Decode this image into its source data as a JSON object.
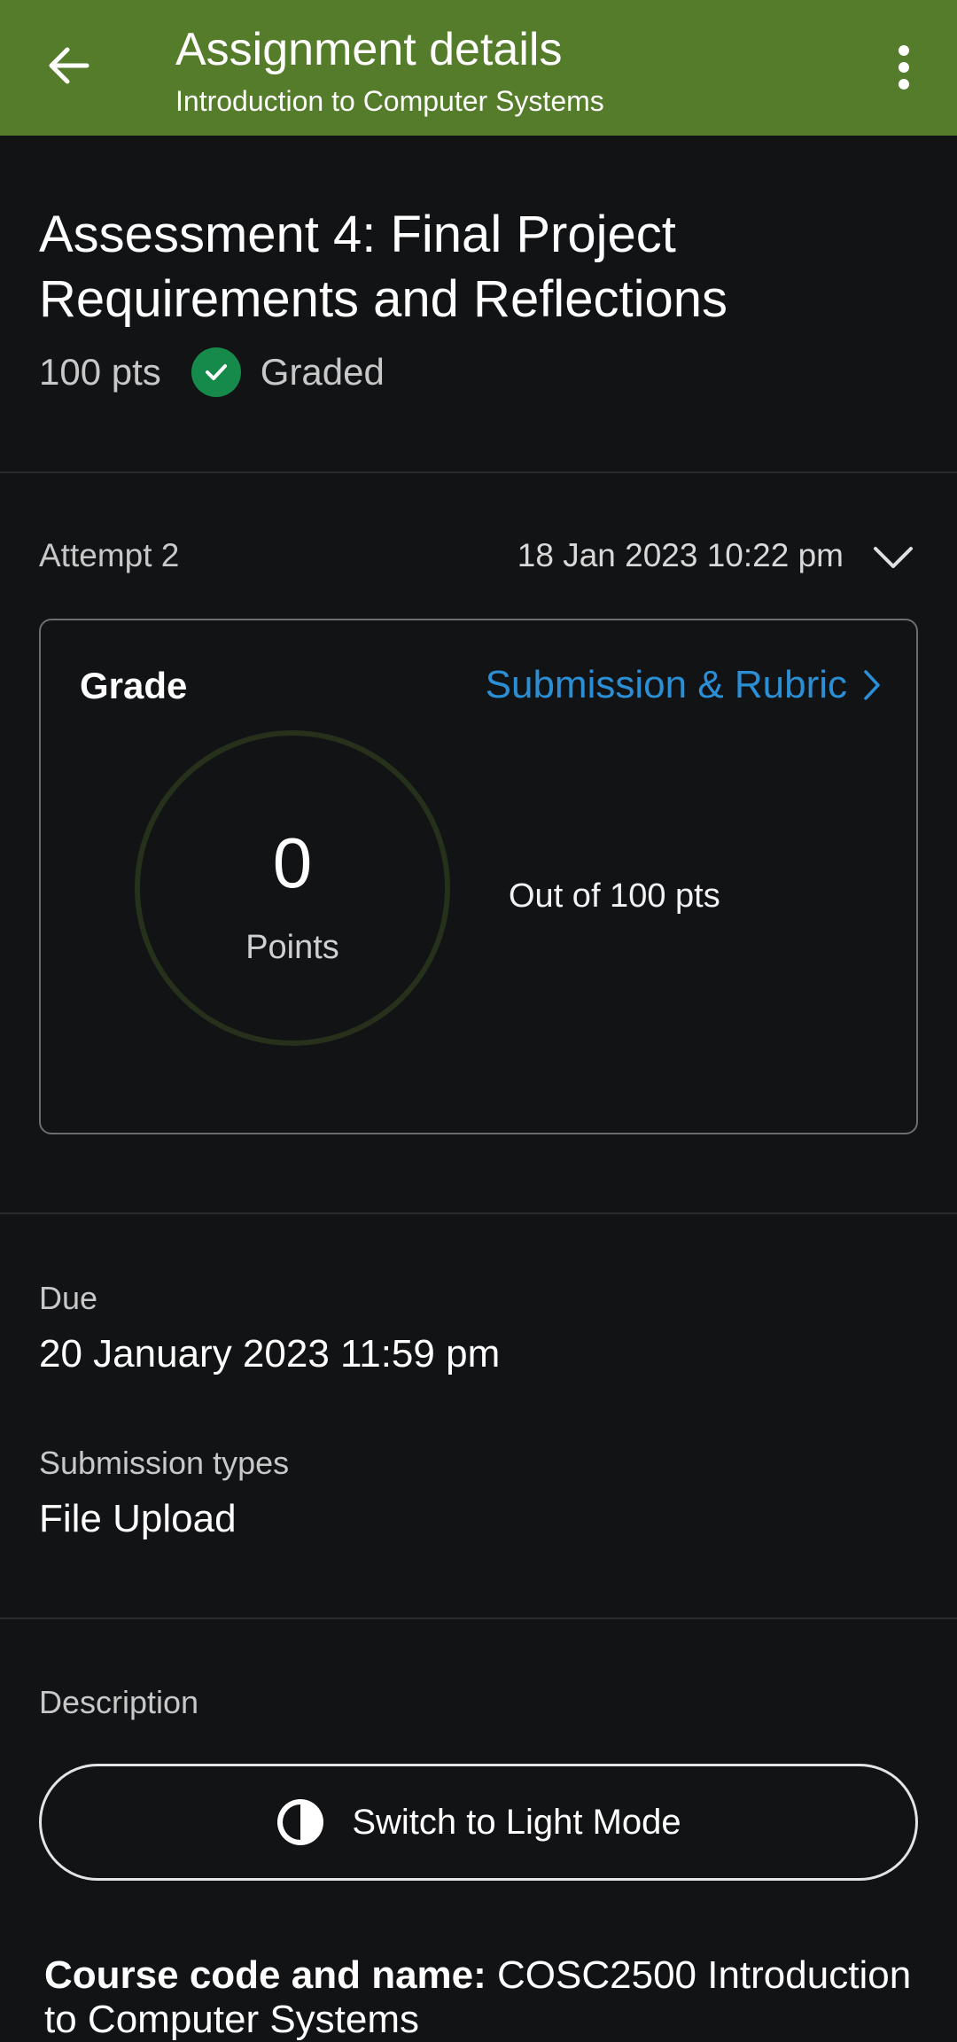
{
  "app_bar": {
    "title": "Assignment details",
    "subtitle": "Introduction to Computer Systems",
    "back_icon": "arrow-left-icon",
    "menu_icon": "more-vertical-icon",
    "color": "#547c2a"
  },
  "assignment": {
    "title": "Assessment 4: Final Project Requirements and Reflections",
    "points": "100 pts",
    "status": "Graded",
    "status_icon": "check-circle-icon",
    "status_color": "#168a4a"
  },
  "attempt": {
    "label": "Attempt 2",
    "date": "18 Jan 2023 10:22 pm",
    "toggle_icon": "chevron-down-icon"
  },
  "grade": {
    "label": "Grade",
    "link_label": "Submission & Rubric",
    "link_color": "#2b8fd6",
    "score": "0",
    "score_caption": "Points",
    "out_of": "Out of 100 pts"
  },
  "details": {
    "due_label": "Due",
    "due_value": "20 January 2023 11:59 pm",
    "types_label": "Submission types",
    "types_value": "File Upload",
    "description_label": "Description"
  },
  "mode_toggle": {
    "label": "Switch to Light Mode",
    "icon": "contrast-icon"
  },
  "description": {
    "course_label": "Course code and name:",
    "course_value": " COSC2500 Introduction to Computer Systems"
  }
}
